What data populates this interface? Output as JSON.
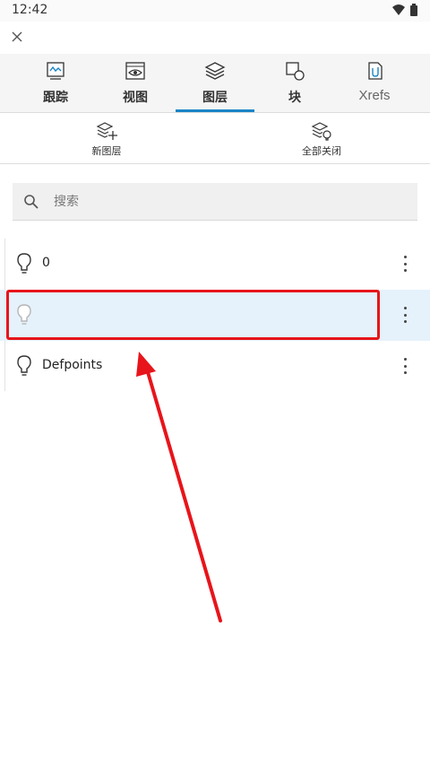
{
  "status_bar": {
    "time": "12:42"
  },
  "tabs": [
    {
      "id": "track",
      "label": "跟踪",
      "icon": "track-icon"
    },
    {
      "id": "view",
      "label": "视图",
      "icon": "eye-icon"
    },
    {
      "id": "layers",
      "label": "图层",
      "icon": "layers-icon",
      "active": true
    },
    {
      "id": "blocks",
      "label": "块",
      "icon": "block-icon"
    },
    {
      "id": "xrefs",
      "label": "Xrefs",
      "icon": "xref-icon"
    }
  ],
  "actions": {
    "new_layer": "新图层",
    "close_all": "全部关闭"
  },
  "search": {
    "placeholder": "搜索",
    "value": ""
  },
  "layers": [
    {
      "name": "0",
      "selected": false
    },
    {
      "name": "",
      "selected": true
    },
    {
      "name": "Defpoints",
      "selected": false
    }
  ],
  "colors": {
    "accent": "#1a84c6",
    "selected_row": "#e5f2fb",
    "annotation": "#e8141b"
  }
}
